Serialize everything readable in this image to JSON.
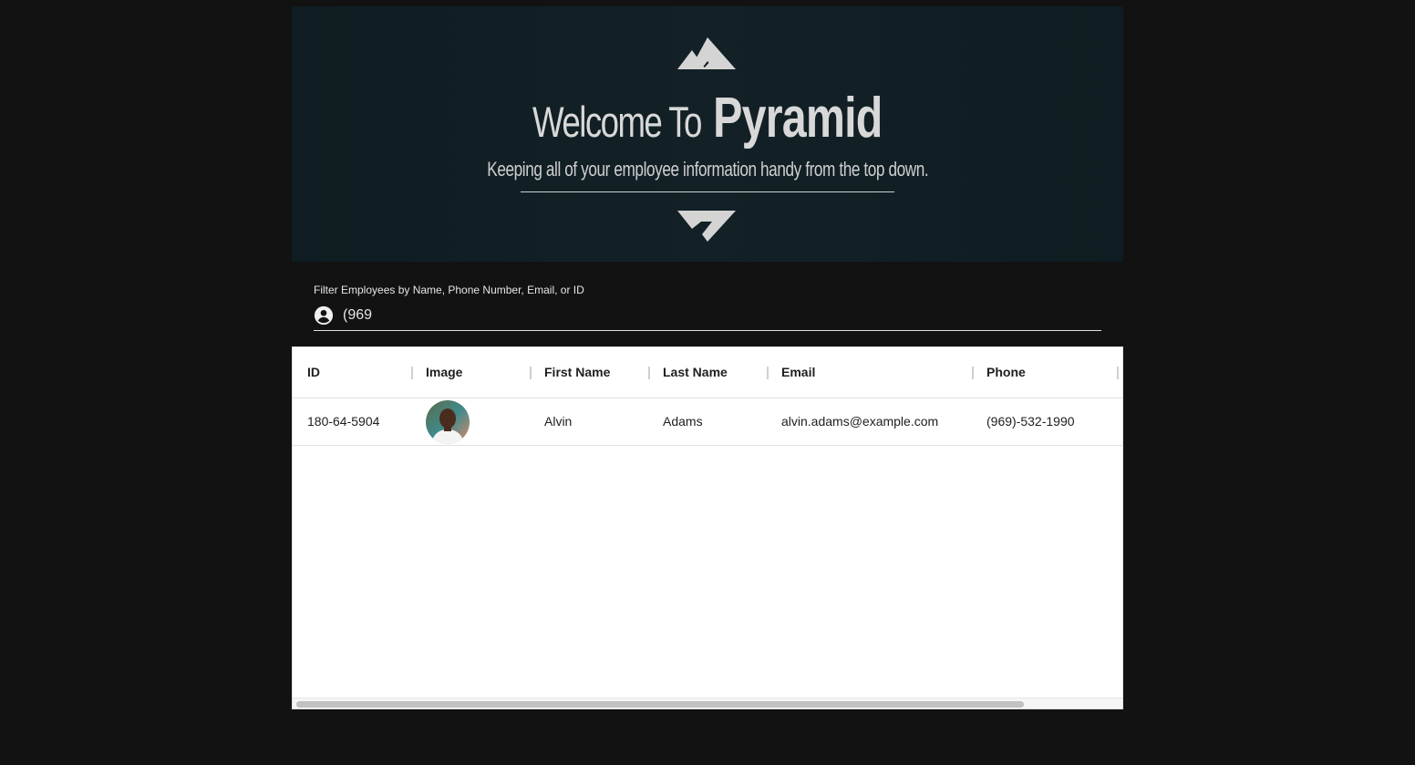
{
  "hero": {
    "welcome": "Welcome To",
    "brand": "Pyramid",
    "subtitle": "Keeping all of your employee information handy from the top down."
  },
  "filter": {
    "label": "Filter Employees by Name, Phone Number, Email, or ID",
    "value": "(969",
    "icon": "account-circle-icon"
  },
  "table": {
    "columns": [
      "ID",
      "Image",
      "First Name",
      "Last Name",
      "Email",
      "Phone"
    ],
    "rows": [
      {
        "id": "180-64-5904",
        "image": "avatar-photo",
        "first_name": "Alvin",
        "last_name": "Adams",
        "email": "alvin.adams@example.com",
        "phone": "(969)-532-1990"
      }
    ]
  },
  "colors": {
    "page_bg": "#121212",
    "hero_bg": "#132127",
    "hero_text": "#d8d8d8",
    "grid_bg": "#ffffff"
  }
}
